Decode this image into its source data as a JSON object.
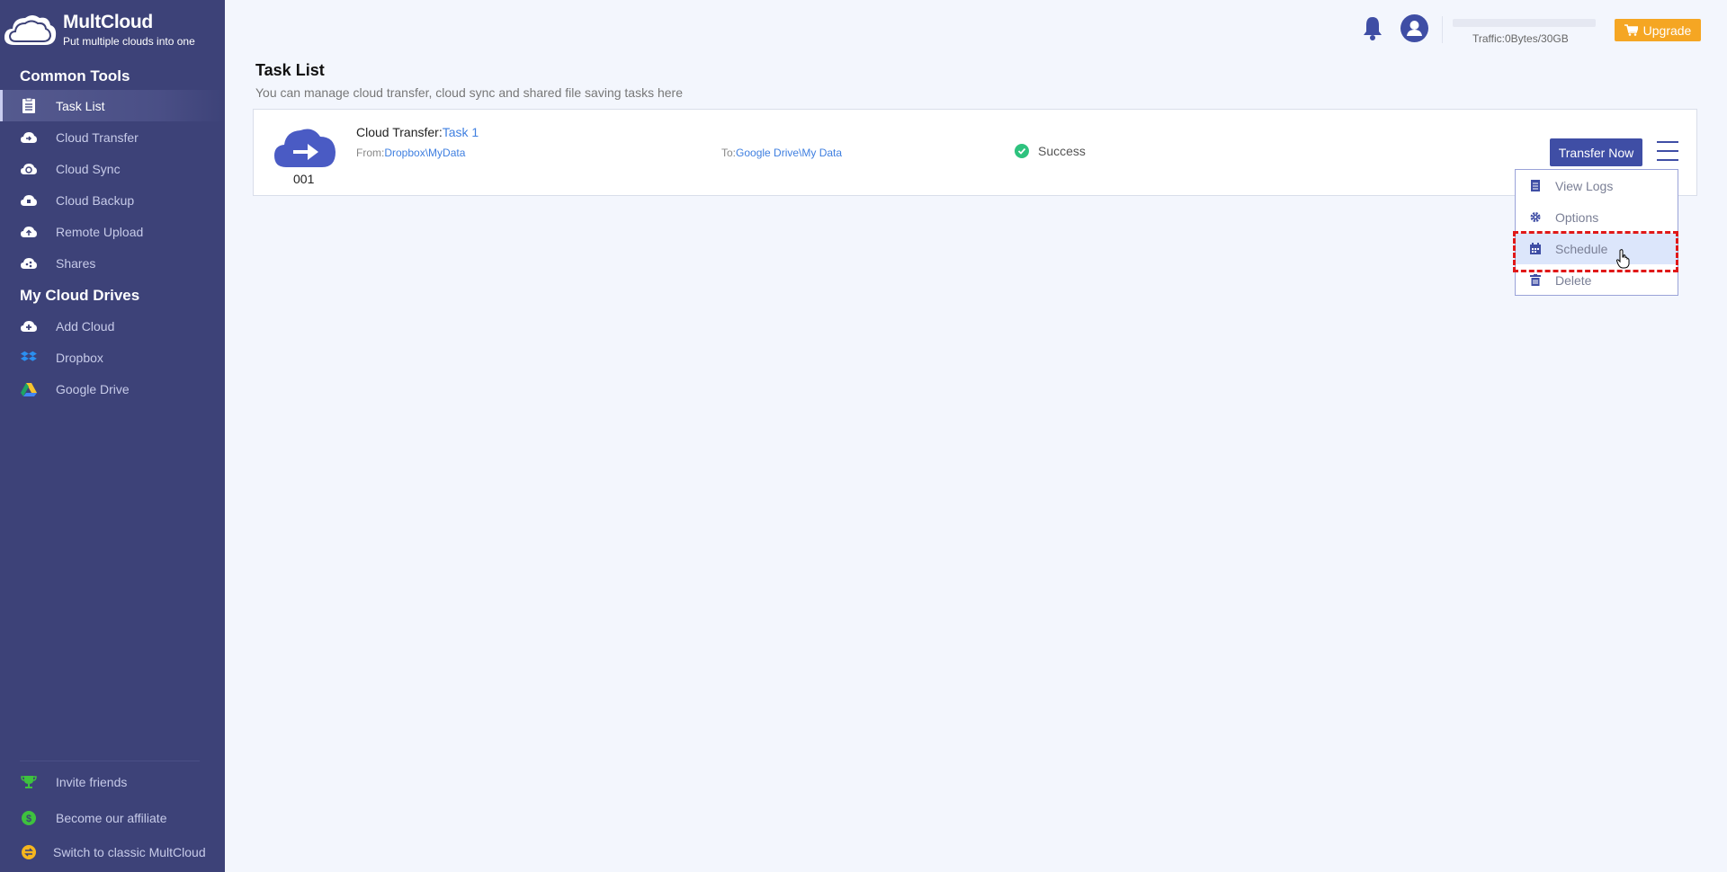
{
  "app": {
    "name": "MultCloud",
    "tagline": "Put multiple clouds into one"
  },
  "sidebar": {
    "common_tools_title": "Common Tools",
    "common_tools": [
      {
        "label": "Task List",
        "icon": "clipboard-list-icon",
        "active": true
      },
      {
        "label": "Cloud Transfer",
        "icon": "cloud-transfer-icon"
      },
      {
        "label": "Cloud Sync",
        "icon": "cloud-sync-icon"
      },
      {
        "label": "Cloud Backup",
        "icon": "cloud-backup-icon"
      },
      {
        "label": "Remote Upload",
        "icon": "cloud-upload-icon"
      },
      {
        "label": "Shares",
        "icon": "cloud-share-icon"
      }
    ],
    "my_cloud_drives_title": "My Cloud Drives",
    "my_cloud_drives": [
      {
        "label": "Add Cloud",
        "icon": "cloud-add-icon"
      },
      {
        "label": "Dropbox",
        "icon": "dropbox-icon"
      },
      {
        "label": "Google Drive",
        "icon": "google-drive-icon"
      }
    ],
    "footer": [
      {
        "label": "Invite friends",
        "icon": "trophy-icon"
      },
      {
        "label": "Become our affiliate",
        "icon": "dollar-icon"
      },
      {
        "label": "Switch to classic MultCloud",
        "icon": "switch-icon"
      }
    ]
  },
  "topbar": {
    "traffic_text": "Traffic:0Bytes/30GB",
    "traffic_used_fraction": 0,
    "upgrade_label": "Upgrade"
  },
  "main": {
    "title": "Task List",
    "subtitle": "You can manage cloud transfer, cloud sync and shared file saving tasks here"
  },
  "task": {
    "number": "001",
    "type_label": "Cloud Transfer:",
    "name": "Task 1",
    "from_label": "From:",
    "from_path": "Dropbox\\MyData",
    "to_label": "To:",
    "to_path": "Google Drive\\My Data",
    "status": "Success",
    "transfer_button": "Transfer Now"
  },
  "task_menu": {
    "items": [
      {
        "label": "View Logs",
        "icon": "list-icon"
      },
      {
        "label": "Options",
        "icon": "gear-icon"
      },
      {
        "label": "Schedule",
        "icon": "calendar-icon",
        "hovered": true
      },
      {
        "label": "Delete",
        "icon": "trash-icon"
      }
    ]
  },
  "colors": {
    "sidebar_bg": "#3d4278",
    "accent": "#3f4ea5",
    "upgrade": "#f5a623",
    "success": "#2ec27e",
    "link": "#3f7fe0",
    "highlight": "#e01818"
  }
}
